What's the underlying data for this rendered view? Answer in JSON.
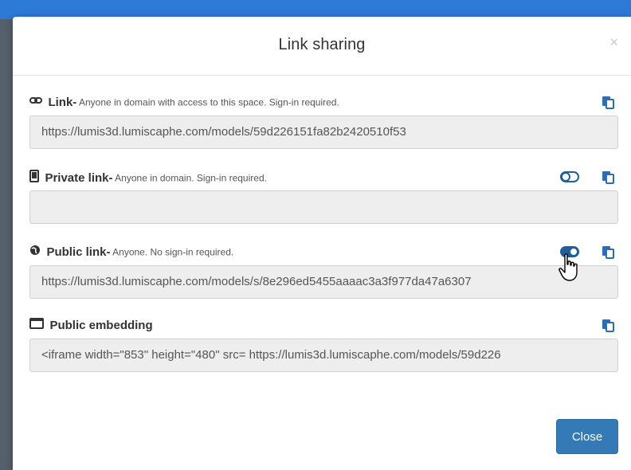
{
  "dialog": {
    "title": "Link sharing",
    "close_x": "×",
    "close_button": "Close"
  },
  "sections": {
    "link": {
      "title": "Link-",
      "description": " Anyone in domain with access to this space. Sign-in required.",
      "value": "https://lumis3d.lumiscaphe.com/models/59d226151fa82b2420510f53"
    },
    "private": {
      "title": "Private link-",
      "description": " Anyone in domain. Sign-in required.",
      "value": "",
      "toggle_on": false
    },
    "public": {
      "title": "Public link-",
      "description": " Anyone. No sign-in required.",
      "value": "https://lumis3d.lumiscaphe.com/models/s/8e296ed5455aaaac3a3f977da47a6307",
      "toggle_on": true
    },
    "embed": {
      "title": "Public embedding",
      "value": "<iframe width=\"853\" height=\"480\" src= https://lumis3d.lumiscaphe.com/models/59d226"
    }
  },
  "icons": {
    "link": "link-icon",
    "private": "tablet-icon",
    "public": "globe-icon",
    "embed": "window-icon",
    "copy": "clipboard-copy-icon",
    "toggle": "toggle-icon",
    "cursor": "hand-pointer-icon"
  },
  "colors": {
    "accent": "#337ab7",
    "copy_icon": "#2a6ebb",
    "toggle_on": "#1f5f9e"
  }
}
